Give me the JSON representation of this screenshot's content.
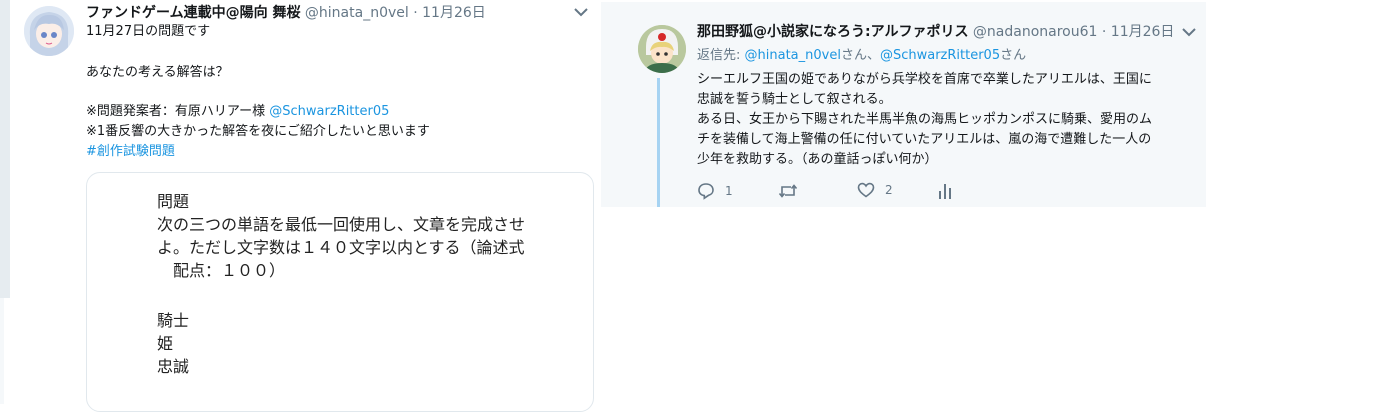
{
  "left_tweet": {
    "author_name": "ファンドゲーム連載中@陽向 舞桜",
    "author_handle": "@hinata_n0vel",
    "separator": "·",
    "date": "11月26日",
    "lines": [
      "11月27日の問題です",
      "あなたの考える解答は？",
      "※問題発案者：有原ハリアー様 ",
      "※1番反響の大きかった解答を夜にご紹介したいと思います"
    ],
    "mention": "@SchwarzRitter05",
    "hashtag": "#創作試験問題",
    "card_lines": [
      "問題",
      "次の三つの単語を最低一回使用し、文章を完成させ",
      "よ。ただし文字数は１４０文字以内とする（論述式",
      "　配点：１００）",
      "騎士",
      "姫",
      "忠誠"
    ]
  },
  "right_tweet": {
    "author_name": "那田野狐@小説家になろう:アルファポリス",
    "author_handle": "@nadanonarou61",
    "separator": "·",
    "date": "11月26日",
    "reply_prefix": "返信先: ",
    "reply_user1": "@hinata_n0vel",
    "reply_mid": "さん、",
    "reply_user2": "@SchwarzRitter05",
    "reply_suffix": "さん",
    "lines": [
      "シーエルフ王国の姫でありながら兵学校を首席で卒業したアリエルは、王国に",
      "忠誠を誓う騎士として叙される。",
      "ある日、女王から下賜された半馬半魚の海馬ヒッポカンポスに騎乗、愛用のム",
      "チを装備して海上警備の任に付いていたアリエルは、嵐の海で遭難した一人の",
      "少年を救助する。（あの童話っぽい何か）"
    ],
    "reply_count": "1",
    "like_count": "2"
  },
  "colors": {
    "link": "#1b95e0",
    "muted": "#657786",
    "thread": "#a6d3f2"
  }
}
